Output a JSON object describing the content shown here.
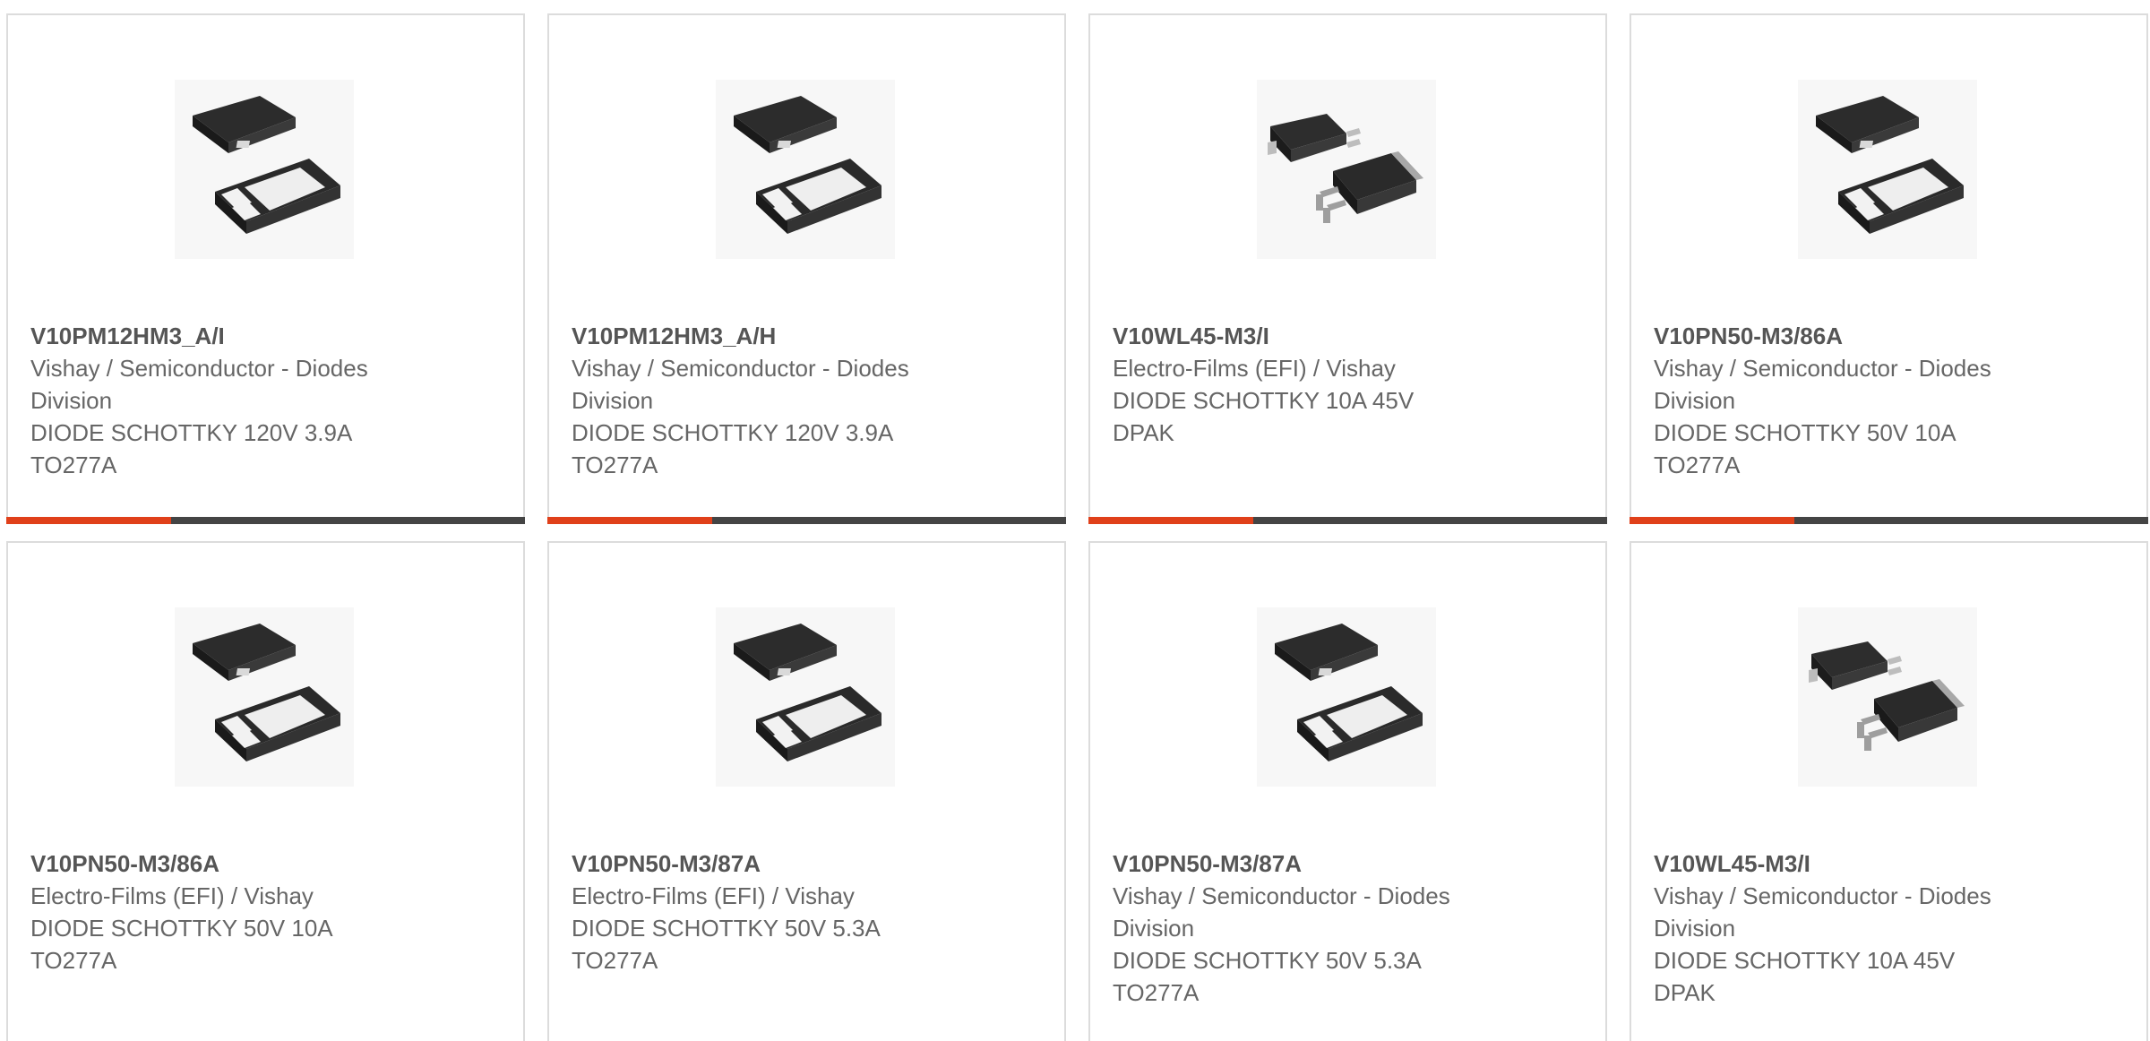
{
  "colors": {
    "accent": "#e0401a",
    "bar": "#444444",
    "border": "#dcdcdc",
    "text": "#666666"
  },
  "cards": [
    {
      "part": "V10PM12HM3_A/I",
      "mfr_line1": "Vishay / Semiconductor - Diodes",
      "mfr_line2": "Division",
      "desc_line1": "DIODE SCHOTTKY 120V 3.9A",
      "desc_line2": "TO277A",
      "image": "to277a-package-icon"
    },
    {
      "part": "V10PM12HM3_A/H",
      "mfr_line1": "Vishay / Semiconductor - Diodes",
      "mfr_line2": "Division",
      "desc_line1": "DIODE SCHOTTKY 120V 3.9A",
      "desc_line2": "TO277A",
      "image": "to277a-package-icon"
    },
    {
      "part": "V10WL45-M3/I",
      "mfr_line1": "Electro-Films (EFI) / Vishay",
      "mfr_line2": "",
      "desc_line1": "DIODE SCHOTTKY 10A 45V",
      "desc_line2": "DPAK",
      "image": "dpak-package-icon"
    },
    {
      "part": "V10PN50-M3/86A",
      "mfr_line1": "Vishay / Semiconductor - Diodes",
      "mfr_line2": "Division",
      "desc_line1": "DIODE SCHOTTKY 50V 10A",
      "desc_line2": "TO277A",
      "image": "to277a-package-icon"
    },
    {
      "part": "V10PN50-M3/86A",
      "mfr_line1": "Electro-Films (EFI) / Vishay",
      "mfr_line2": "",
      "desc_line1": "DIODE SCHOTTKY 50V 10A",
      "desc_line2": "TO277A",
      "image": "to277a-package-icon"
    },
    {
      "part": "V10PN50-M3/87A",
      "mfr_line1": "Electro-Films (EFI) / Vishay",
      "mfr_line2": "",
      "desc_line1": "DIODE SCHOTTKY 50V 5.3A",
      "desc_line2": "TO277A",
      "image": "to277a-package-icon"
    },
    {
      "part": "V10PN50-M3/87A",
      "mfr_line1": "Vishay / Semiconductor - Diodes",
      "mfr_line2": "Division",
      "desc_line1": "DIODE SCHOTTKY 50V 5.3A",
      "desc_line2": "TO277A",
      "image": "to277a-package-icon"
    },
    {
      "part": "V10WL45-M3/I",
      "mfr_line1": "Vishay / Semiconductor - Diodes",
      "mfr_line2": "Division",
      "desc_line1": "DIODE SCHOTTKY 10A 45V",
      "desc_line2": "DPAK",
      "image": "dpak-package-icon"
    }
  ]
}
